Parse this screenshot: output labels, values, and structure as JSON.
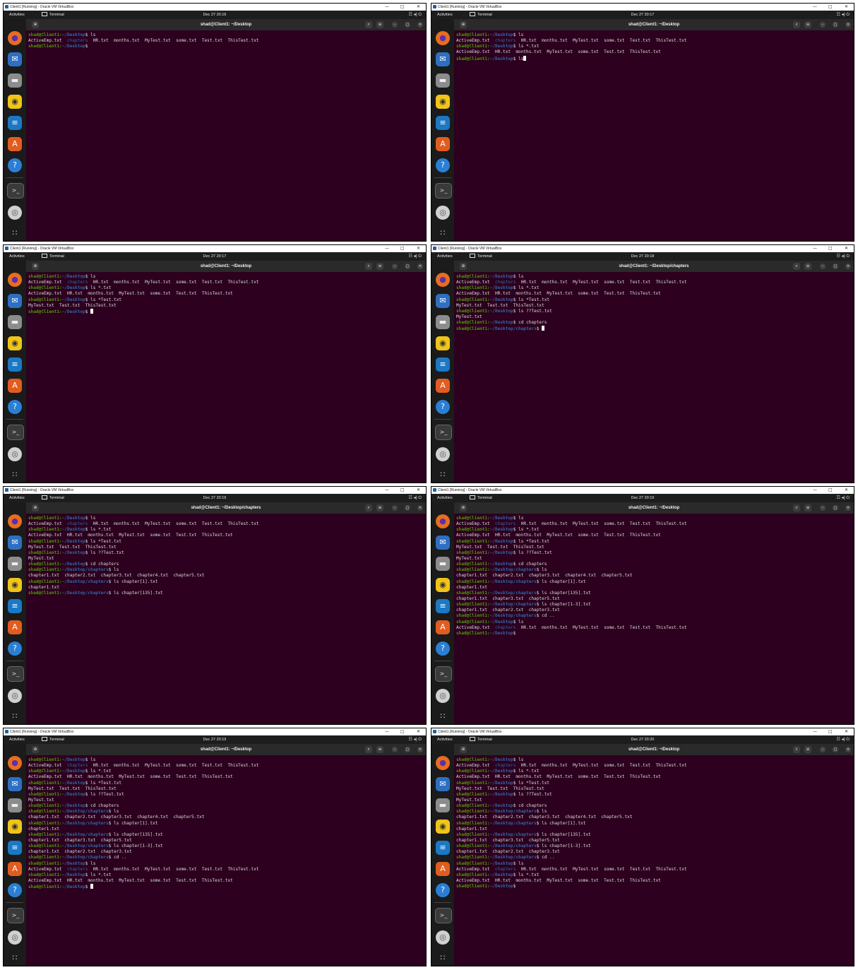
{
  "window": {
    "vbox_title": "Client1 [Running] - Oracle VM VirtualBox",
    "activities": "Activities",
    "app_name": "Terminal",
    "prompt_user": "shad@Client1:",
    "prompt_suffix": "$",
    "icon_names": [
      "firefox-icon",
      "thunderbird-icon",
      "files-icon",
      "rhythmbox-icon",
      "writer-icon",
      "software-icon",
      "help-icon",
      "terminal-icon",
      "disc-icon",
      "apps-grid-icon"
    ],
    "colors": {
      "terminal_bg": "#2c001e",
      "prompt_user": "#4e9a06",
      "prompt_path": "#3465a4",
      "text": "#dddddd"
    }
  },
  "panels": [
    {
      "clock": "Dec 27  20:16",
      "title": "shad@Client1: ~/Desktop",
      "cursor": false,
      "lines": [
        {
          "path": "~/Desktop",
          "cmd": " ls"
        },
        {
          "out": [
            [
              "ActiveEmp.txt  ",
              ""
            ],
            [
              "chapters",
              "dir"
            ],
            [
              "  HR.txt  months.txt  MyTest.txt  some.txt  Test.txt  ThisTest.txt",
              ""
            ]
          ]
        },
        {
          "path": "~/Desktop",
          "cmd": ""
        }
      ]
    },
    {
      "clock": "Dec 27  20:17",
      "title": "shad@Client1: ~/Desktop",
      "cursor": true,
      "lines": [
        {
          "path": "~/Desktop",
          "cmd": " ls"
        },
        {
          "out": [
            [
              "ActiveEmp.txt  ",
              ""
            ],
            [
              "chapters",
              "dir"
            ],
            [
              "  HR.txt  months.txt  MyTest.txt  some.txt  Test.txt  ThisTest.txt",
              ""
            ]
          ]
        },
        {
          "path": "~/Desktop",
          "cmd": " ls *.txt"
        },
        {
          "out": [
            [
              "ActiveEmp.txt  HR.txt  months.txt  MyTest.txt  some.txt  Test.txt  ThisTest.txt",
              ""
            ]
          ]
        },
        {
          "path": "~/Desktop",
          "cmd": " ls"
        }
      ]
    },
    {
      "clock": "Dec 27  20:17",
      "title": "shad@Client1: ~/Desktop",
      "cursor": true,
      "lines": [
        {
          "path": "~/Desktop",
          "cmd": " ls"
        },
        {
          "out": [
            [
              "ActiveEmp.txt  ",
              ""
            ],
            [
              "chapters",
              "dir"
            ],
            [
              "  HR.txt  months.txt  MyTest.txt  some.txt  Test.txt  ThisTest.txt",
              ""
            ]
          ]
        },
        {
          "path": "~/Desktop",
          "cmd": " ls *.txt"
        },
        {
          "out": [
            [
              "ActiveEmp.txt  HR.txt  months.txt  MyTest.txt  some.txt  Test.txt  ThisTest.txt",
              ""
            ]
          ]
        },
        {
          "path": "~/Desktop",
          "cmd": " ls *Test.txt"
        },
        {
          "out": [
            [
              "MyTest.txt  Test.txt  ThisTest.txt",
              ""
            ]
          ]
        },
        {
          "path": "~/Desktop",
          "cmd": " "
        }
      ]
    },
    {
      "clock": "Dec 27  20:18",
      "title": "shad@Client1: ~/Desktop/chapters",
      "cursor": true,
      "lines": [
        {
          "path": "~/Desktop",
          "cmd": " ls"
        },
        {
          "out": [
            [
              "ActiveEmp.txt  ",
              ""
            ],
            [
              "chapters",
              "dir"
            ],
            [
              "  HR.txt  months.txt  MyTest.txt  some.txt  Test.txt  ThisTest.txt",
              ""
            ]
          ]
        },
        {
          "path": "~/Desktop",
          "cmd": " ls *.txt"
        },
        {
          "out": [
            [
              "ActiveEmp.txt  HR.txt  months.txt  MyTest.txt  some.txt  Test.txt  ThisTest.txt",
              ""
            ]
          ]
        },
        {
          "path": "~/Desktop",
          "cmd": " ls *Test.txt"
        },
        {
          "out": [
            [
              "MyTest.txt  Test.txt  ThisTest.txt",
              ""
            ]
          ]
        },
        {
          "path": "~/Desktop",
          "cmd": " ls ??Test.txt"
        },
        {
          "out": [
            [
              "MyTest.txt",
              ""
            ]
          ]
        },
        {
          "path": "~/Desktop",
          "cmd": " cd chapters"
        },
        {
          "path": "~/Desktop/chapters",
          "cmd": " "
        }
      ]
    },
    {
      "clock": "Dec 27  20:19",
      "title": "shad@Client1: ~/Desktop/chapters",
      "cursor": false,
      "lines": [
        {
          "path": "~/Desktop",
          "cmd": " ls"
        },
        {
          "out": [
            [
              "ActiveEmp.txt  ",
              ""
            ],
            [
              "chapters",
              "dir"
            ],
            [
              "  HR.txt  months.txt  MyTest.txt  some.txt  Test.txt  ThisTest.txt",
              ""
            ]
          ]
        },
        {
          "path": "~/Desktop",
          "cmd": " ls *.txt"
        },
        {
          "out": [
            [
              "ActiveEmp.txt  HR.txt  months.txt  MyTest.txt  some.txt  Test.txt  ThisTest.txt",
              ""
            ]
          ]
        },
        {
          "path": "~/Desktop",
          "cmd": " ls *Test.txt"
        },
        {
          "out": [
            [
              "MyTest.txt  Test.txt  ThisTest.txt",
              ""
            ]
          ]
        },
        {
          "path": "~/Desktop",
          "cmd": " ls ??Test.txt"
        },
        {
          "out": [
            [
              "MyTest.txt",
              ""
            ]
          ]
        },
        {
          "path": "~/Desktop",
          "cmd": " cd chapters"
        },
        {
          "path": "~/Desktop/chapters",
          "cmd": " ls"
        },
        {
          "out": [
            [
              "chapter1.txt  chapter2.txt  chapter3.txt  chapter4.txt  chapter5.txt",
              ""
            ]
          ]
        },
        {
          "path": "~/Desktop/chapters",
          "cmd": " ls chapter[1].txt"
        },
        {
          "out": [
            [
              "chapter1.txt",
              ""
            ]
          ]
        },
        {
          "path": "~/Desktop/chapters",
          "cmd": " ls chapter[135].txt"
        }
      ]
    },
    {
      "clock": "Dec 27  20:19",
      "title": "shad@Client1: ~/Desktop",
      "cursor": false,
      "lines": [
        {
          "path": "~/Desktop",
          "cmd": " ls"
        },
        {
          "out": [
            [
              "ActiveEmp.txt  ",
              ""
            ],
            [
              "chapters",
              "dir"
            ],
            [
              "  HR.txt  months.txt  MyTest.txt  some.txt  Test.txt  ThisTest.txt",
              ""
            ]
          ]
        },
        {
          "path": "~/Desktop",
          "cmd": " ls *.txt"
        },
        {
          "out": [
            [
              "ActiveEmp.txt  HR.txt  months.txt  MyTest.txt  some.txt  Test.txt  ThisTest.txt",
              ""
            ]
          ]
        },
        {
          "path": "~/Desktop",
          "cmd": " ls *Test.txt"
        },
        {
          "out": [
            [
              "MyTest.txt  Test.txt  ThisTest.txt",
              ""
            ]
          ]
        },
        {
          "path": "~/Desktop",
          "cmd": " ls ??Test.txt"
        },
        {
          "out": [
            [
              "MyTest.txt",
              ""
            ]
          ]
        },
        {
          "path": "~/Desktop",
          "cmd": " cd chapters"
        },
        {
          "path": "~/Desktop/chapters",
          "cmd": " ls"
        },
        {
          "out": [
            [
              "chapter1.txt  chapter2.txt  chapter3.txt  chapter4.txt  chapter5.txt",
              ""
            ]
          ]
        },
        {
          "path": "~/Desktop/chapters",
          "cmd": " ls chapter[1].txt"
        },
        {
          "out": [
            [
              "chapter1.txt",
              ""
            ]
          ]
        },
        {
          "path": "~/Desktop/chapters",
          "cmd": " ls chapter[135].txt"
        },
        {
          "out": [
            [
              "chapter1.txt  chapter3.txt  chapter5.txt",
              ""
            ]
          ]
        },
        {
          "path": "~/Desktop/chapters",
          "cmd": " ls chapter[1-3].txt"
        },
        {
          "out": [
            [
              "chapter1.txt  chapter2.txt  chapter3.txt",
              ""
            ]
          ]
        },
        {
          "path": "~/Desktop/chapters",
          "cmd": " cd .."
        },
        {
          "path": "~/Desktop",
          "cmd": " ls"
        },
        {
          "out": [
            [
              "ActiveEmp.txt  ",
              ""
            ],
            [
              "chapters",
              "dir"
            ],
            [
              "  HR.txt  months.txt  MyTest.txt  some.txt  Test.txt  ThisTest.txt",
              ""
            ]
          ]
        },
        {
          "path": "~/Desktop",
          "cmd": ""
        }
      ]
    },
    {
      "clock": "Dec 27  20:19",
      "title": "shad@Client1: ~/Desktop",
      "cursor": true,
      "lines": [
        {
          "path": "~/Desktop",
          "cmd": " ls"
        },
        {
          "out": [
            [
              "ActiveEmp.txt  ",
              ""
            ],
            [
              "chapters",
              "dir"
            ],
            [
              "  HR.txt  months.txt  MyTest.txt  some.txt  Test.txt  ThisTest.txt",
              ""
            ]
          ]
        },
        {
          "path": "~/Desktop",
          "cmd": " ls *.txt"
        },
        {
          "out": [
            [
              "ActiveEmp.txt  HR.txt  months.txt  MyTest.txt  some.txt  Test.txt  ThisTest.txt",
              ""
            ]
          ]
        },
        {
          "path": "~/Desktop",
          "cmd": " ls *Test.txt"
        },
        {
          "out": [
            [
              "MyTest.txt  Test.txt  ThisTest.txt",
              ""
            ]
          ]
        },
        {
          "path": "~/Desktop",
          "cmd": " ls ??Test.txt"
        },
        {
          "out": [
            [
              "MyTest.txt",
              ""
            ]
          ]
        },
        {
          "path": "~/Desktop",
          "cmd": " cd chapters"
        },
        {
          "path": "~/Desktop/chapters",
          "cmd": " ls"
        },
        {
          "out": [
            [
              "chapter1.txt  chapter2.txt  chapter3.txt  chapter4.txt  chapter5.txt",
              ""
            ]
          ]
        },
        {
          "path": "~/Desktop/chapters",
          "cmd": " ls chapter[1].txt"
        },
        {
          "out": [
            [
              "chapter1.txt",
              ""
            ]
          ]
        },
        {
          "path": "~/Desktop/chapters",
          "cmd": " ls chapter[135].txt"
        },
        {
          "out": [
            [
              "chapter1.txt  chapter3.txt  chapter5.txt",
              ""
            ]
          ]
        },
        {
          "path": "~/Desktop/chapters",
          "cmd": " ls chapter[1-3].txt"
        },
        {
          "out": [
            [
              "chapter1.txt  chapter2.txt  chapter3.txt",
              ""
            ]
          ]
        },
        {
          "path": "~/Desktop/chapters",
          "cmd": " cd .."
        },
        {
          "path": "~/Desktop",
          "cmd": " ls"
        },
        {
          "out": [
            [
              "ActiveEmp.txt  ",
              ""
            ],
            [
              "chapters",
              "dir"
            ],
            [
              "  HR.txt  months.txt  MyTest.txt  some.txt  Test.txt  ThisTest.txt",
              ""
            ]
          ]
        },
        {
          "path": "~/Desktop",
          "cmd": " ls *.txt"
        },
        {
          "out": [
            [
              "ActiveEmp.txt  HR.txt  months.txt  MyTest.txt  some.txt  Test.txt  ThisTest.txt",
              ""
            ]
          ]
        },
        {
          "path": "~/Desktop",
          "cmd": " "
        }
      ]
    },
    {
      "clock": "Dec 27  20:20",
      "title": "shad@Client1: ~/Desktop",
      "cursor": false,
      "lines": [
        {
          "path": "~/Desktop",
          "cmd": " ls"
        },
        {
          "out": [
            [
              "ActiveEmp.txt  ",
              ""
            ],
            [
              "chapters",
              "dir"
            ],
            [
              "  HR.txt  months.txt  MyTest.txt  some.txt  Test.txt  ThisTest.txt",
              ""
            ]
          ]
        },
        {
          "path": "~/Desktop",
          "cmd": " ls *.txt"
        },
        {
          "out": [
            [
              "ActiveEmp.txt  HR.txt  months.txt  MyTest.txt  some.txt  Test.txt  ThisTest.txt",
              ""
            ]
          ]
        },
        {
          "path": "~/Desktop",
          "cmd": " ls *Test.txt"
        },
        {
          "out": [
            [
              "MyTest.txt  Test.txt  ThisTest.txt",
              ""
            ]
          ]
        },
        {
          "path": "~/Desktop",
          "cmd": " ls ??Test.txt"
        },
        {
          "out": [
            [
              "MyTest.txt",
              ""
            ]
          ]
        },
        {
          "path": "~/Desktop",
          "cmd": " cd chapters"
        },
        {
          "path": "~/Desktop/chapters",
          "cmd": " ls"
        },
        {
          "out": [
            [
              "chapter1.txt  chapter2.txt  chapter3.txt  chapter4.txt  chapter5.txt",
              ""
            ]
          ]
        },
        {
          "path": "~/Desktop/chapters",
          "cmd": " ls chapter[1].txt"
        },
        {
          "out": [
            [
              "chapter1.txt",
              ""
            ]
          ]
        },
        {
          "path": "~/Desktop/chapters",
          "cmd": " ls chapter[135].txt"
        },
        {
          "out": [
            [
              "chapter1.txt  chapter3.txt  chapter5.txt",
              ""
            ]
          ]
        },
        {
          "path": "~/Desktop/chapters",
          "cmd": " ls chapter[1-3].txt"
        },
        {
          "out": [
            [
              "chapter1.txt  chapter2.txt  chapter3.txt",
              ""
            ]
          ]
        },
        {
          "path": "~/Desktop/chapters",
          "cmd": " cd .."
        },
        {
          "path": "~/Desktop",
          "cmd": " ls"
        },
        {
          "out": [
            [
              "ActiveEmp.txt  ",
              ""
            ],
            [
              "chapters",
              "dir"
            ],
            [
              "  HR.txt  months.txt  MyTest.txt  some.txt  Test.txt  ThisTest.txt",
              ""
            ]
          ]
        },
        {
          "path": "~/Desktop",
          "cmd": " ls *.txt"
        },
        {
          "out": [
            [
              "ActiveEmp.txt  HR.txt  months.txt  MyTest.txt  some.txt  Test.txt  ThisTest.txt",
              ""
            ]
          ]
        },
        {
          "path": "~/Desktop",
          "cmd": ""
        }
      ]
    }
  ]
}
